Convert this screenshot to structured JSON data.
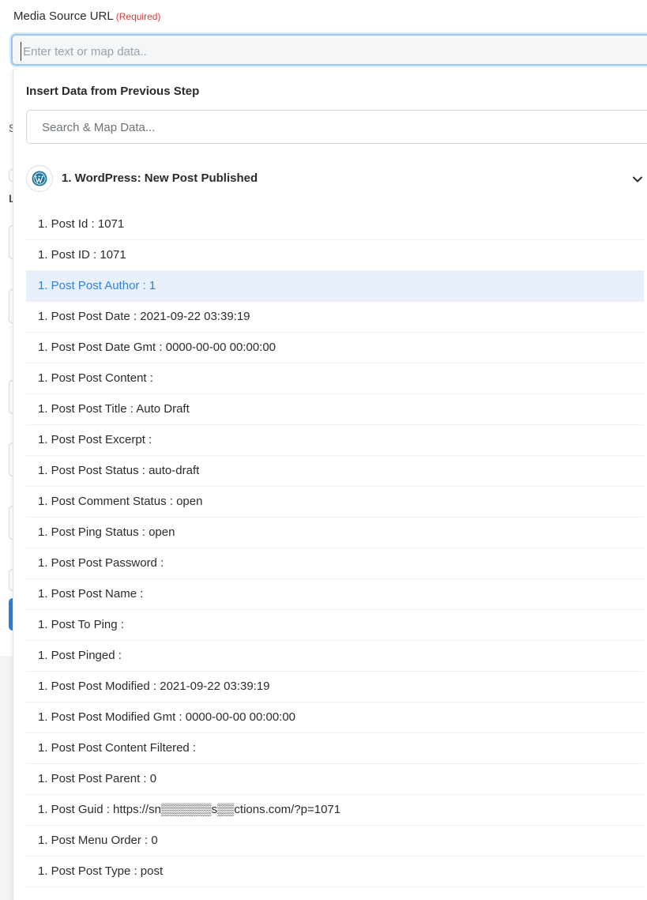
{
  "field": {
    "label": "Media Source URL",
    "required_label": "(Required)",
    "placeholder": "Enter text or map data.."
  },
  "background_letters": [
    "S",
    "L"
  ],
  "dropdown": {
    "title": "Insert Data from Previous Step",
    "search_placeholder": "Search & Map Data...",
    "step": {
      "title": "1. WordPress: New Post Published",
      "icon": "wordpress-icon",
      "expand_icon": "chevron-down-icon"
    },
    "items": [
      "1. Post Id : 1071",
      "1. Post ID : 1071",
      "1. Post Post Author : 1",
      "1. Post Post Date : 2021-09-22 03:39:19",
      "1. Post Post Date Gmt : 0000-00-00 00:00:00",
      "1. Post Post Content :",
      "1. Post Post Title : Auto Draft",
      "1. Post Post Excerpt :",
      "1. Post Post Status : auto-draft",
      "1. Post Comment Status : open",
      "1. Post Ping Status : open",
      "1. Post Post Password :",
      "1. Post Post Name :",
      "1. Post To Ping :",
      "1. Post Pinged :",
      "1. Post Post Modified : 2021-09-22 03:39:19",
      "1. Post Post Modified Gmt : 0000-00-00 00:00:00",
      "1. Post Post Content Filtered :",
      "1. Post Post Parent : 0",
      "1. Post Guid : https://sn▒▒▒▒▒▒s▒▒ctions.com/?p=1071",
      "1. Post Menu Order : 0",
      "1. Post Post Type : post"
    ],
    "active_index": 2
  },
  "colors": {
    "accent": "#2f82d8",
    "required": "#d93a3a",
    "active_row_bg": "#e8f1fb",
    "input_focus_border": "#9ec5ee"
  }
}
